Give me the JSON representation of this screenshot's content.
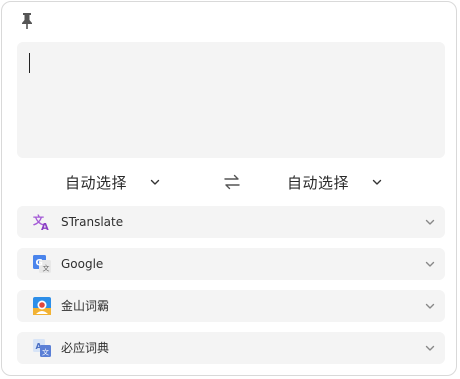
{
  "toolbar": {
    "pin_icon": "pin-icon"
  },
  "input": {
    "value": ""
  },
  "languages": {
    "source": "自动选择",
    "target": "自动选择",
    "swap_icon": "swap-arrows-icon"
  },
  "services": [
    {
      "name": "STranslate",
      "icon": "stranslate-logo-icon",
      "color": "#a45ad6"
    },
    {
      "name": "Google",
      "icon": "google-translate-icon",
      "color": "#4a84ec"
    },
    {
      "name": "金山词霸",
      "icon": "iciba-icon",
      "color": "#2d8ee8"
    },
    {
      "name": "必应词典",
      "icon": "bing-dict-icon",
      "color": "#5a7fd6"
    }
  ]
}
